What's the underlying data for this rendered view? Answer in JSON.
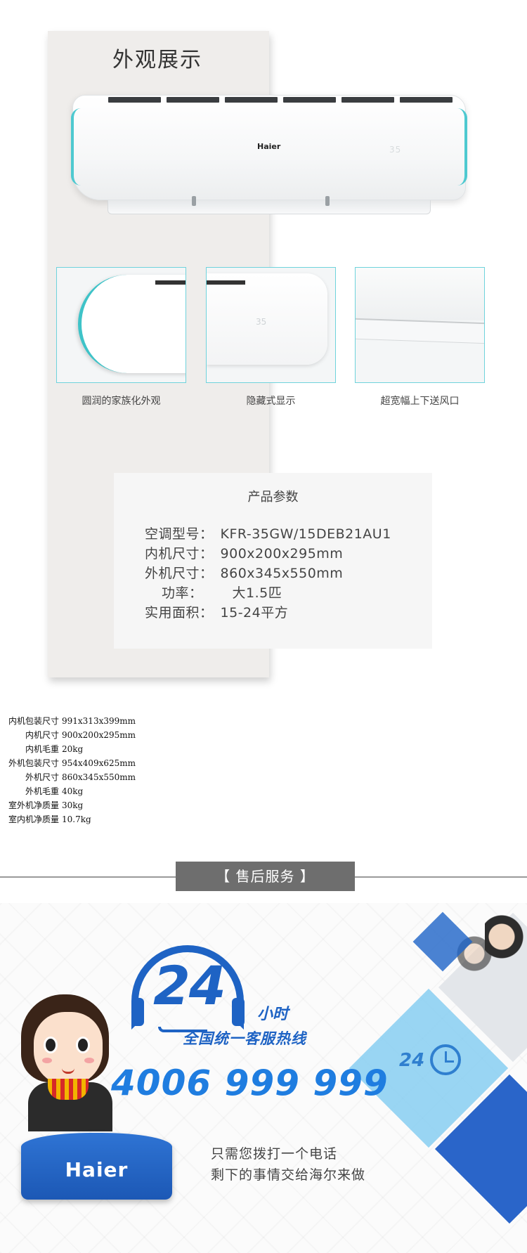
{
  "appearance": {
    "title": "外观展示",
    "unit_logo": "Haier",
    "unit_display": "35",
    "detail_captions": [
      "圆润的家族化外观",
      "隐藏式显示",
      "超宽幅上下送风口"
    ]
  },
  "specs": {
    "title": "产品参数",
    "rows": [
      {
        "key": "空调型号：",
        "value": "KFR-35GW/15DEB21AU1"
      },
      {
        "key": "内机尺寸：",
        "value": "900x200x295mm"
      },
      {
        "key": "外机尺寸：",
        "value": "860x345x550mm"
      },
      {
        "key": "功率：",
        "value": "大1.5匹"
      },
      {
        "key": "实用面积：",
        "value": "15-24平方"
      }
    ]
  },
  "packaging": [
    {
      "key": "内机包装尺寸",
      "value": "991x313x399mm"
    },
    {
      "key": "内机尺寸",
      "value": "900x200x295mm"
    },
    {
      "key": "内机毛重",
      "value": "20kg"
    },
    {
      "key": "外机包装尺寸",
      "value": "954x409x625mm"
    },
    {
      "key": "外机尺寸",
      "value": "860x345x550mm"
    },
    {
      "key": "外机毛重",
      "value": "40kg"
    },
    {
      "key": "室外机净质量",
      "value": "30kg"
    },
    {
      "key": "室内机净质量",
      "value": "10.7kg"
    }
  ],
  "after_sales": {
    "banner": "【 售后服务 】",
    "big_number": "24",
    "hours": "小时",
    "hotline_label": "全国统一客服热线",
    "phone": "4006 999 999",
    "tagline_1": "只需您拨打一个电话",
    "tagline_2": "剩下的事情交给海尔来做",
    "desk_logo": "Haier",
    "tile_number": "24"
  },
  "colors": {
    "brand_blue": "#1e63c4",
    "accent_teal": "#4ec9d0",
    "banner_grey": "#6e6e6e"
  }
}
